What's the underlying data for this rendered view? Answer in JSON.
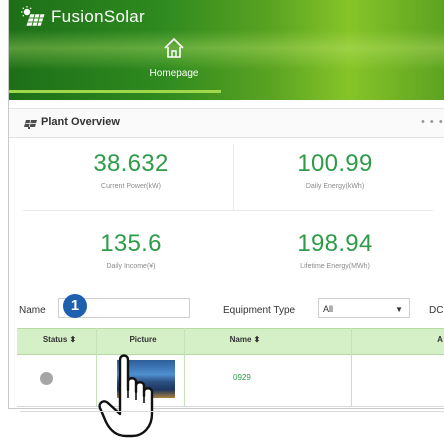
{
  "app": {
    "title": "FusionSolar"
  },
  "nav": {
    "home_label": "Homepage"
  },
  "panel": {
    "title": "Plant Overview",
    "more": "• • •"
  },
  "kpis": [
    {
      "value": "38.632",
      "label": "Current Power(kW)"
    },
    {
      "value": "100.99",
      "label": "Daily Energy(kWh)"
    },
    {
      "value": "135.6",
      "label": "Daily Income(¥)"
    },
    {
      "value": "198.94",
      "label": "Lifetime Energy(MWh)"
    }
  ],
  "filters": {
    "name_label": "Name",
    "name_value": "",
    "step_badge": "1",
    "equipment_type_label": "Equipment Type",
    "equipment_type_value": "All",
    "dc_label": "DC"
  },
  "table": {
    "columns": [
      "Status ⬍",
      "Picture",
      "Name ⬍",
      "A"
    ],
    "rows": [
      {
        "status": "offline",
        "name": "0929"
      }
    ]
  },
  "colors": {
    "accent": "#2e9b48",
    "header_green": "#2f8a1f",
    "table_header": "#d5efc7",
    "badge": "#1f5fb0"
  }
}
